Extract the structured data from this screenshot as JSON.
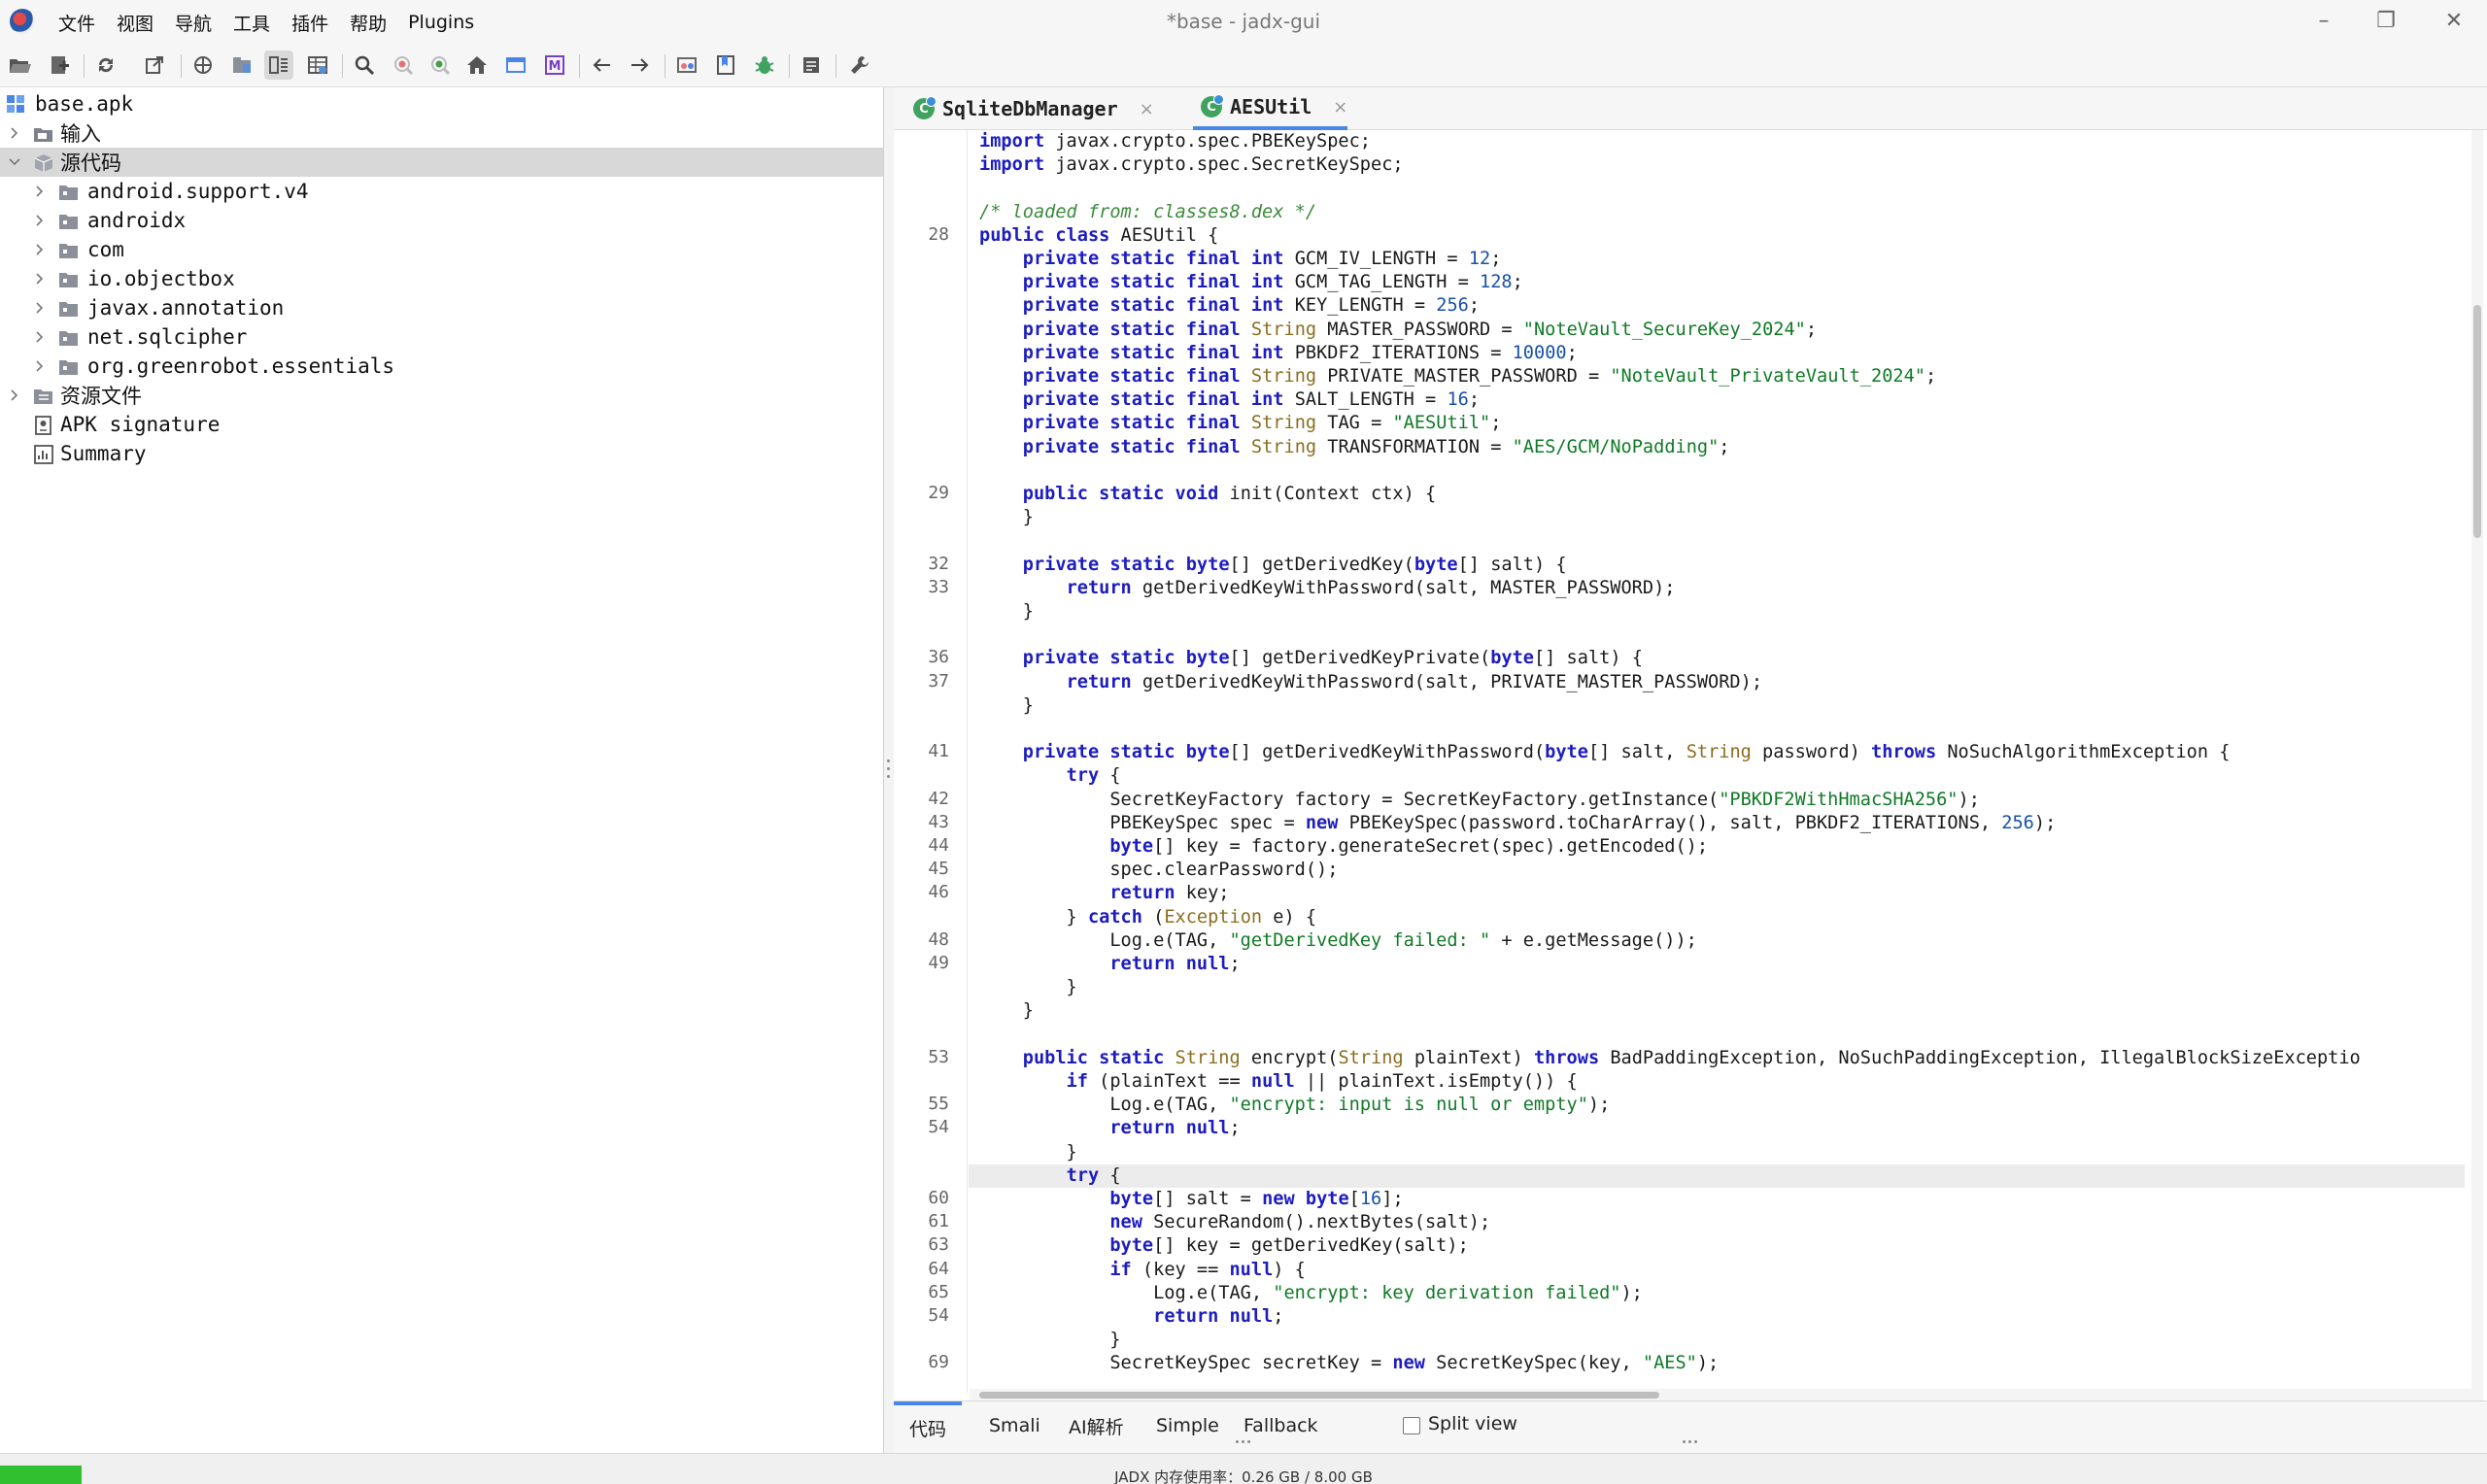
{
  "window": {
    "title": "*base - jadx-gui",
    "menus": [
      "文件",
      "视图",
      "导航",
      "工具",
      "插件",
      "帮助",
      "Plugins"
    ],
    "controls": [
      "–",
      "❐",
      "✕"
    ]
  },
  "toolbar": {
    "icons": [
      "open-icon",
      "add-files-icon",
      "reload-icon",
      "export-icon",
      "sync-icon",
      "flatten-packages-icon",
      "code-view-icon",
      "table-view-icon",
      "search-icon",
      "find-usage-icon",
      "text-search-icon",
      "home-icon",
      "decompile-icon",
      "m-icon",
      "back-icon",
      "forward-icon",
      "quark-icon",
      "deobfuscation-icon",
      "debug-icon",
      "log-icon",
      "preferences-icon"
    ]
  },
  "tree": {
    "root": "base.apk",
    "items": [
      {
        "label": "输入",
        "level": 1,
        "icon": "input"
      },
      {
        "label": "源代码",
        "level": 1,
        "icon": "source",
        "selected": true,
        "expanded": true
      },
      {
        "label": "android.support.v4",
        "level": 2,
        "icon": "package"
      },
      {
        "label": "androidx",
        "level": 2,
        "icon": "package"
      },
      {
        "label": "com",
        "level": 2,
        "icon": "package"
      },
      {
        "label": "io.objectbox",
        "level": 2,
        "icon": "package"
      },
      {
        "label": "javax.annotation",
        "level": 2,
        "icon": "package"
      },
      {
        "label": "net.sqlcipher",
        "level": 2,
        "icon": "package"
      },
      {
        "label": "org.greenrobot.essentials",
        "level": 2,
        "icon": "package"
      },
      {
        "label": "资源文件",
        "level": 1,
        "icon": "resources"
      },
      {
        "label": "APK signature",
        "level": 1,
        "icon": "signature"
      },
      {
        "label": "Summary",
        "level": 1,
        "icon": "summary"
      }
    ]
  },
  "tabs": [
    {
      "label": "SqliteDbManager",
      "close": "×",
      "active": false
    },
    {
      "label": "AESUtil",
      "close": "×",
      "active": true
    }
  ],
  "code": {
    "lines": [
      {
        "n": "",
        "text": "import javax.crypto.spec.PBEKeySpec;"
      },
      {
        "n": "",
        "text": "import javax.crypto.spec.SecretKeySpec;"
      },
      {
        "n": "",
        "text": ""
      },
      {
        "n": "",
        "text": "/* loaded from: classes8.dex */"
      },
      {
        "n": "28",
        "text": "public class AESUtil {"
      },
      {
        "n": "",
        "text": "    private static final int GCM_IV_LENGTH = 12;"
      },
      {
        "n": "",
        "text": "    private static final int GCM_TAG_LENGTH = 128;"
      },
      {
        "n": "",
        "text": "    private static final int KEY_LENGTH = 256;"
      },
      {
        "n": "",
        "text": "    private static final String MASTER_PASSWORD = \"NoteVault_SecureKey_2024\";"
      },
      {
        "n": "",
        "text": "    private static final int PBKDF2_ITERATIONS = 10000;"
      },
      {
        "n": "",
        "text": "    private static final String PRIVATE_MASTER_PASSWORD = \"NoteVault_PrivateVault_2024\";"
      },
      {
        "n": "",
        "text": "    private static final int SALT_LENGTH = 16;"
      },
      {
        "n": "",
        "text": "    private static final String TAG = \"AESUtil\";"
      },
      {
        "n": "",
        "text": "    private static final String TRANSFORMATION = \"AES/GCM/NoPadding\";"
      },
      {
        "n": "",
        "text": ""
      },
      {
        "n": "29",
        "text": "    public static void init(Context ctx) {"
      },
      {
        "n": "",
        "text": "    }"
      },
      {
        "n": "",
        "text": ""
      },
      {
        "n": "32",
        "text": "    private static byte[] getDerivedKey(byte[] salt) {"
      },
      {
        "n": "33",
        "text": "        return getDerivedKeyWithPassword(salt, MASTER_PASSWORD);"
      },
      {
        "n": "",
        "text": "    }"
      },
      {
        "n": "",
        "text": ""
      },
      {
        "n": "36",
        "text": "    private static byte[] getDerivedKeyPrivate(byte[] salt) {"
      },
      {
        "n": "37",
        "text": "        return getDerivedKeyWithPassword(salt, PRIVATE_MASTER_PASSWORD);"
      },
      {
        "n": "",
        "text": "    }"
      },
      {
        "n": "",
        "text": ""
      },
      {
        "n": "41",
        "text": "    private static byte[] getDerivedKeyWithPassword(byte[] salt, String password) throws NoSuchAlgorithmException {"
      },
      {
        "n": "",
        "text": "        try {"
      },
      {
        "n": "42",
        "text": "            SecretKeyFactory factory = SecretKeyFactory.getInstance(\"PBKDF2WithHmacSHA256\");"
      },
      {
        "n": "43",
        "text": "            PBEKeySpec spec = new PBEKeySpec(password.toCharArray(), salt, PBKDF2_ITERATIONS, 256);"
      },
      {
        "n": "44",
        "text": "            byte[] key = factory.generateSecret(spec).getEncoded();"
      },
      {
        "n": "45",
        "text": "            spec.clearPassword();"
      },
      {
        "n": "46",
        "text": "            return key;"
      },
      {
        "n": "",
        "text": "        } catch (Exception e) {"
      },
      {
        "n": "48",
        "text": "            Log.e(TAG, \"getDerivedKey failed: \" + e.getMessage());"
      },
      {
        "n": "49",
        "text": "            return null;"
      },
      {
        "n": "",
        "text": "        }"
      },
      {
        "n": "",
        "text": "    }"
      },
      {
        "n": "",
        "text": ""
      },
      {
        "n": "53",
        "text": "    public static String encrypt(String plainText) throws BadPaddingException, NoSuchPaddingException, IllegalBlockSizeExceptio"
      },
      {
        "n": "",
        "text": "        if (plainText == null || plainText.isEmpty()) {"
      },
      {
        "n": "55",
        "text": "            Log.e(TAG, \"encrypt: input is null or empty\");"
      },
      {
        "n": "54",
        "text": "            return null;"
      },
      {
        "n": "",
        "text": "        }"
      },
      {
        "n": "",
        "text": "        try {",
        "highlight": true
      },
      {
        "n": "60",
        "text": "            byte[] salt = new byte[16];"
      },
      {
        "n": "61",
        "text": "            new SecureRandom().nextBytes(salt);"
      },
      {
        "n": "63",
        "text": "            byte[] key = getDerivedKey(salt);"
      },
      {
        "n": "64",
        "text": "            if (key == null) {"
      },
      {
        "n": "65",
        "text": "                Log.e(TAG, \"encrypt: key derivation failed\");"
      },
      {
        "n": "54",
        "text": "                return null;"
      },
      {
        "n": "",
        "text": "            }"
      },
      {
        "n": "69",
        "text": "            SecretKeySpec secretKey = new SecretKeySpec(key, \"AES\");"
      }
    ]
  },
  "bottom_tabs": [
    "代码",
    "Smali",
    "AI解析",
    "Simple",
    "Fallback"
  ],
  "split_view": {
    "label": "Split view",
    "checked": false
  },
  "status": {
    "memory": "JADX 内存使用率：0.26 GB / 8.00 GB",
    "memory_fraction": 0.0325
  }
}
